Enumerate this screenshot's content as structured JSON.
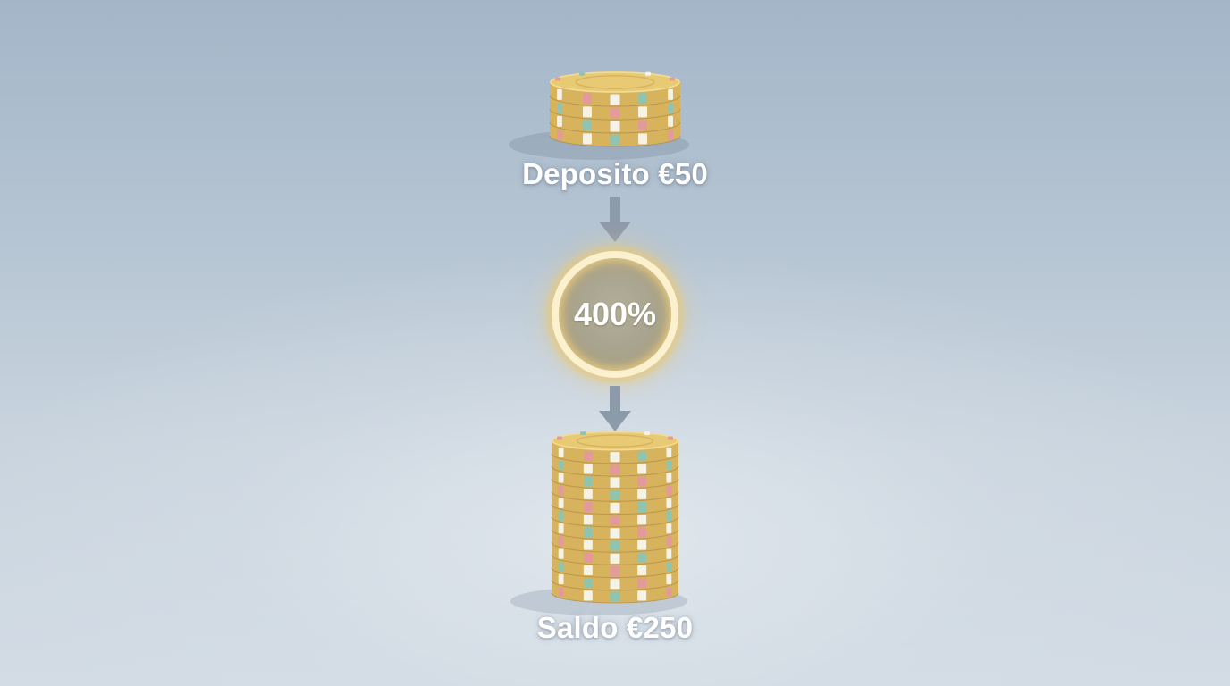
{
  "deposit_label": "Deposito €50",
  "bonus_percent": "400%",
  "balance_label": "Saldo €250",
  "colors": {
    "chip": "#e8c974",
    "chip_edge": "#d7b35e",
    "chip_rim_light": "#f3dc95",
    "stripe_red": "#e39a9a",
    "stripe_teal": "#8fc4b0",
    "stripe_white": "#f7f2e6",
    "arrow": "#8d9aa9",
    "badge_ring": "#fbf1cf"
  },
  "icons": {
    "arrow": "arrow-down-icon",
    "chip": "casino-chip-icon"
  },
  "stacks": {
    "deposit_chip_count": 4,
    "balance_chip_count": 12
  }
}
